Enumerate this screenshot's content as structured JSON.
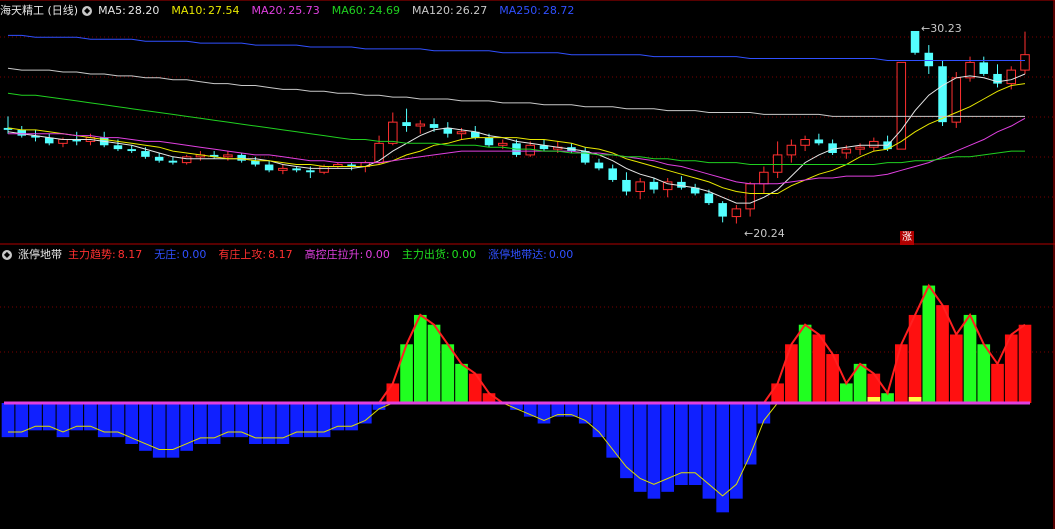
{
  "main_panel": {
    "title": "海天精工 (日线)",
    "indicators": [
      {
        "label": "MA5:",
        "value": "28.20",
        "color": "#e6e6e6"
      },
      {
        "label": "MA10:",
        "value": "27.54",
        "color": "#e8e800"
      },
      {
        "label": "MA20:",
        "value": "25.73",
        "color": "#e040e0"
      },
      {
        "label": "MA60:",
        "value": "24.69",
        "color": "#20d020"
      },
      {
        "label": "MA120:",
        "value": "26.27",
        "color": "#c8c8c8"
      },
      {
        "label": "MA250:",
        "value": "28.72",
        "color": "#3050ff"
      }
    ],
    "high_label": "30.23",
    "low_label": "20.24",
    "limit_up_badge": "涨"
  },
  "sub_panel": {
    "title": "涨停地带",
    "indicators": [
      {
        "label": "主力趋势:",
        "value": "8.17",
        "color": "#ff3030"
      },
      {
        "label": "无庄:",
        "value": "0.00",
        "color": "#3050ff"
      },
      {
        "label": "有庄上攻:",
        "value": "8.17",
        "color": "#ff3030"
      },
      {
        "label": "高控庄拉升:",
        "value": "0.00",
        "color": "#e040e0"
      },
      {
        "label": "主力出货:",
        "value": "0.00",
        "color": "#20e020"
      },
      {
        "label": "涨停地带达:",
        "value": "0.00",
        "color": "#3050ff"
      }
    ]
  },
  "colors": {
    "up": "#ff3030",
    "down": "#54ffff",
    "grid": "#7a0000",
    "bg": "#000000"
  },
  "chart_data": {
    "type": "candlestick",
    "candles": [
      [
        25.2,
        25.8,
        24.9,
        25.1
      ],
      [
        25.1,
        25.3,
        24.7,
        24.8
      ],
      [
        24.8,
        25.1,
        24.5,
        24.7
      ],
      [
        24.7,
        24.9,
        24.3,
        24.4
      ],
      [
        24.4,
        24.7,
        24.2,
        24.6
      ],
      [
        24.6,
        25.0,
        24.3,
        24.5
      ],
      [
        24.5,
        24.9,
        24.3,
        24.7
      ],
      [
        24.7,
        25.0,
        24.2,
        24.3
      ],
      [
        24.3,
        24.6,
        24.0,
        24.1
      ],
      [
        24.1,
        24.3,
        23.9,
        24.0
      ],
      [
        24.0,
        24.2,
        23.6,
        23.7
      ],
      [
        23.7,
        23.9,
        23.4,
        23.5
      ],
      [
        23.5,
        23.7,
        23.3,
        23.4
      ],
      [
        23.4,
        23.8,
        23.3,
        23.7
      ],
      [
        23.7,
        24.0,
        23.5,
        23.8
      ],
      [
        23.8,
        24.0,
        23.6,
        23.7
      ],
      [
        23.7,
        24.0,
        23.5,
        23.8
      ],
      [
        23.8,
        23.9,
        23.4,
        23.5
      ],
      [
        23.5,
        23.7,
        23.2,
        23.3
      ],
      [
        23.3,
        23.5,
        22.9,
        23.0
      ],
      [
        23.0,
        23.3,
        22.8,
        23.1
      ],
      [
        23.1,
        23.2,
        22.9,
        23.0
      ],
      [
        23.0,
        23.2,
        22.6,
        22.9
      ],
      [
        22.9,
        23.3,
        22.8,
        23.2
      ],
      [
        23.2,
        23.4,
        23.1,
        23.3
      ],
      [
        23.3,
        23.4,
        23.0,
        23.2
      ],
      [
        23.2,
        23.5,
        22.9,
        23.4
      ],
      [
        23.4,
        24.8,
        23.3,
        24.4
      ],
      [
        24.4,
        26.0,
        24.3,
        25.5
      ],
      [
        25.5,
        26.2,
        25.0,
        25.3
      ],
      [
        25.3,
        25.6,
        24.9,
        25.4
      ],
      [
        25.4,
        25.7,
        25.0,
        25.2
      ],
      [
        25.2,
        25.5,
        24.7,
        24.9
      ],
      [
        24.9,
        25.2,
        24.6,
        25.0
      ],
      [
        25.0,
        25.3,
        24.6,
        24.7
      ],
      [
        24.7,
        24.9,
        24.2,
        24.3
      ],
      [
        24.3,
        24.6,
        24.1,
        24.4
      ],
      [
        24.4,
        24.6,
        23.7,
        23.8
      ],
      [
        23.8,
        24.5,
        23.7,
        24.3
      ],
      [
        24.3,
        24.6,
        24.0,
        24.1
      ],
      [
        24.1,
        24.5,
        23.9,
        24.2
      ],
      [
        24.2,
        24.4,
        23.9,
        24.0
      ],
      [
        24.0,
        24.2,
        23.3,
        23.4
      ],
      [
        23.4,
        23.6,
        23.0,
        23.1
      ],
      [
        23.1,
        23.3,
        22.4,
        22.5
      ],
      [
        22.5,
        22.9,
        21.7,
        21.9
      ],
      [
        21.9,
        22.6,
        21.5,
        22.4
      ],
      [
        22.4,
        22.6,
        21.8,
        22.0
      ],
      [
        22.0,
        22.6,
        21.6,
        22.4
      ],
      [
        22.4,
        22.7,
        22.0,
        22.1
      ],
      [
        22.1,
        22.3,
        21.7,
        21.8
      ],
      [
        21.8,
        22.0,
        21.2,
        21.3
      ],
      [
        21.3,
        21.4,
        20.3,
        20.6
      ],
      [
        20.6,
        21.2,
        20.24,
        21.0
      ],
      [
        21.0,
        22.4,
        20.6,
        22.3
      ],
      [
        22.3,
        23.2,
        21.8,
        22.9
      ],
      [
        22.9,
        24.5,
        22.6,
        23.8
      ],
      [
        23.8,
        24.6,
        23.4,
        24.3
      ],
      [
        24.3,
        24.8,
        24.0,
        24.6
      ],
      [
        24.6,
        24.9,
        24.3,
        24.4
      ],
      [
        24.4,
        24.6,
        23.8,
        23.9
      ],
      [
        23.9,
        24.3,
        23.6,
        24.1
      ],
      [
        24.1,
        24.4,
        23.8,
        24.2
      ],
      [
        24.2,
        24.7,
        24.0,
        24.5
      ],
      [
        24.5,
        24.8,
        24.0,
        24.1
      ],
      [
        24.1,
        28.6,
        28.4,
        28.6
      ],
      [
        30.23,
        30.23,
        29.0,
        29.1
      ],
      [
        29.1,
        29.5,
        28.0,
        28.4
      ],
      [
        28.4,
        28.7,
        25.3,
        25.5
      ],
      [
        25.5,
        28.1,
        25.2,
        27.8
      ],
      [
        27.8,
        28.9,
        27.6,
        28.6
      ],
      [
        28.6,
        28.9,
        27.9,
        28.0
      ],
      [
        28.0,
        28.5,
        27.3,
        27.5
      ],
      [
        27.5,
        28.4,
        27.2,
        28.2
      ],
      [
        28.2,
        30.2,
        28.0,
        29.0
      ]
    ],
    "ma": {
      "MA5": [
        25.0,
        24.9,
        24.8,
        24.7,
        24.6,
        24.6,
        24.6,
        24.5,
        24.4,
        24.3,
        24.1,
        23.9,
        23.7,
        23.6,
        23.6,
        23.6,
        23.6,
        23.6,
        23.6,
        23.5,
        23.3,
        23.2,
        23.1,
        23.1,
        23.1,
        23.1,
        23.2,
        23.5,
        24.0,
        24.4,
        24.8,
        25.1,
        25.2,
        25.1,
        25.0,
        24.8,
        24.7,
        24.5,
        24.4,
        24.3,
        24.2,
        24.1,
        24.0,
        23.8,
        23.5,
        23.1,
        22.8,
        22.6,
        22.3,
        22.2,
        22.1,
        21.9,
        21.6,
        21.3,
        21.3,
        21.6,
        22.0,
        22.7,
        23.4,
        23.8,
        24.1,
        24.2,
        24.3,
        24.3,
        24.3,
        25.1,
        26.1,
        26.9,
        27.4,
        27.8,
        27.9,
        27.8,
        27.6,
        27.7,
        28.0
      ],
      "MA10": [
        25.2,
        25.1,
        25.1,
        25.0,
        24.9,
        24.8,
        24.7,
        24.6,
        24.5,
        24.4,
        24.3,
        24.2,
        24.0,
        23.9,
        23.8,
        23.7,
        23.6,
        23.6,
        23.5,
        23.5,
        23.4,
        23.3,
        23.3,
        23.2,
        23.2,
        23.2,
        23.2,
        23.3,
        23.5,
        23.8,
        24.0,
        24.3,
        24.4,
        24.6,
        24.7,
        24.7,
        24.7,
        24.7,
        24.6,
        24.6,
        24.5,
        24.4,
        24.2,
        24.1,
        23.9,
        23.6,
        23.4,
        23.2,
        23.0,
        22.8,
        22.6,
        22.4,
        22.1,
        21.9,
        21.8,
        21.8,
        21.8,
        22.2,
        22.5,
        22.8,
        23.0,
        23.3,
        23.7,
        24.0,
        24.1,
        24.5,
        25.0,
        25.4,
        25.7,
        26.0,
        26.3,
        26.7,
        27.1,
        27.4,
        27.5
      ],
      "MA20": [
        24.9,
        24.9,
        24.9,
        24.9,
        24.9,
        24.8,
        24.8,
        24.7,
        24.7,
        24.6,
        24.5,
        24.5,
        24.4,
        24.3,
        24.2,
        24.1,
        24.0,
        23.9,
        23.8,
        23.8,
        23.7,
        23.6,
        23.5,
        23.5,
        23.4,
        23.4,
        23.4,
        23.4,
        23.5,
        23.6,
        23.7,
        23.8,
        23.9,
        24.0,
        24.0,
        24.0,
        24.0,
        24.0,
        24.0,
        24.0,
        24.0,
        24.0,
        23.9,
        23.9,
        23.8,
        23.7,
        23.6,
        23.5,
        23.3,
        23.2,
        23.0,
        22.8,
        22.6,
        22.4,
        22.3,
        22.3,
        22.3,
        22.4,
        22.5,
        22.6,
        22.6,
        22.7,
        22.7,
        22.7,
        22.8,
        23.0,
        23.2,
        23.4,
        23.7,
        24.0,
        24.3,
        24.6,
        25.0,
        25.3,
        25.7
      ],
      "MA60": [
        27.0,
        26.9,
        26.9,
        26.8,
        26.7,
        26.6,
        26.5,
        26.4,
        26.3,
        26.2,
        26.1,
        26.0,
        25.9,
        25.8,
        25.7,
        25.6,
        25.5,
        25.4,
        25.3,
        25.2,
        25.1,
        25.0,
        24.9,
        24.8,
        24.7,
        24.6,
        24.6,
        24.5,
        24.5,
        24.4,
        24.4,
        24.4,
        24.3,
        24.3,
        24.3,
        24.2,
        24.2,
        24.1,
        24.1,
        24.0,
        24.0,
        23.9,
        23.9,
        23.8,
        23.8,
        23.7,
        23.7,
        23.6,
        23.6,
        23.5,
        23.5,
        23.4,
        23.4,
        23.4,
        23.3,
        23.3,
        23.3,
        23.3,
        23.3,
        23.3,
        23.3,
        23.3,
        23.3,
        23.3,
        23.4,
        23.4,
        23.5,
        23.5,
        23.6,
        23.7,
        23.7,
        23.8,
        23.9,
        24.0,
        24.0
      ],
      "MA120": [
        28.3,
        28.2,
        28.2,
        28.2,
        28.1,
        28.1,
        28.0,
        28.0,
        27.9,
        27.9,
        27.8,
        27.8,
        27.7,
        27.7,
        27.6,
        27.5,
        27.5,
        27.4,
        27.4,
        27.3,
        27.2,
        27.2,
        27.1,
        27.1,
        27.0,
        27.0,
        26.9,
        26.9,
        26.8,
        26.8,
        26.7,
        26.7,
        26.7,
        26.6,
        26.6,
        26.6,
        26.5,
        26.5,
        26.5,
        26.4,
        26.4,
        26.4,
        26.3,
        26.3,
        26.3,
        26.2,
        26.2,
        26.2,
        26.1,
        26.1,
        26.1,
        26.0,
        26.0,
        26.0,
        26.0,
        25.9,
        25.9,
        25.9,
        25.9,
        25.9,
        25.8,
        25.8,
        25.8,
        25.8,
        25.8,
        25.8,
        25.8,
        25.8,
        25.8,
        25.8,
        25.8,
        25.8,
        25.8,
        25.8,
        25.8
      ],
      "MA250": [
        30.0,
        30.0,
        29.9,
        29.9,
        29.9,
        29.9,
        29.8,
        29.8,
        29.8,
        29.8,
        29.7,
        29.7,
        29.7,
        29.7,
        29.6,
        29.6,
        29.6,
        29.6,
        29.5,
        29.5,
        29.5,
        29.5,
        29.4,
        29.4,
        29.4,
        29.4,
        29.3,
        29.3,
        29.3,
        29.3,
        29.3,
        29.2,
        29.2,
        29.2,
        29.2,
        29.2,
        29.1,
        29.1,
        29.1,
        29.1,
        29.1,
        29.0,
        29.0,
        29.0,
        29.0,
        29.0,
        29.0,
        28.9,
        28.9,
        28.9,
        28.9,
        28.9,
        28.9,
        28.9,
        28.8,
        28.8,
        28.8,
        28.8,
        28.8,
        28.8,
        28.8,
        28.8,
        28.8,
        28.8,
        28.7,
        28.7,
        28.7,
        28.7,
        28.7,
        28.7,
        28.7,
        28.7,
        28.7,
        28.7,
        28.7
      ]
    },
    "sub_values": [
      -5,
      -5,
      -4,
      -4,
      -5,
      -4,
      -4,
      -5,
      -5,
      -6,
      -7,
      -8,
      -8,
      -7,
      -6,
      -6,
      -5,
      -5,
      -6,
      -6,
      -6,
      -5,
      -5,
      -5,
      -4,
      -4,
      -3,
      -1,
      2,
      6,
      9,
      8,
      6,
      4,
      3,
      1,
      0,
      -1,
      -2,
      -3,
      -2,
      -2,
      -3,
      -5,
      -8,
      -11,
      -13,
      -14,
      -13,
      -12,
      -12,
      -14,
      -16,
      -14,
      -9,
      -3,
      2,
      6,
      8,
      7,
      5,
      2,
      4,
      3,
      1,
      6,
      9,
      12,
      10,
      7,
      9,
      6,
      4,
      7,
      8
    ],
    "sub_yellow": [
      63,
      66
    ],
    "sub_ylim": [
      -18,
      14
    ],
    "ylim": [
      19.8,
      30.8
    ],
    "high": 30.23,
    "low": 20.24
  }
}
